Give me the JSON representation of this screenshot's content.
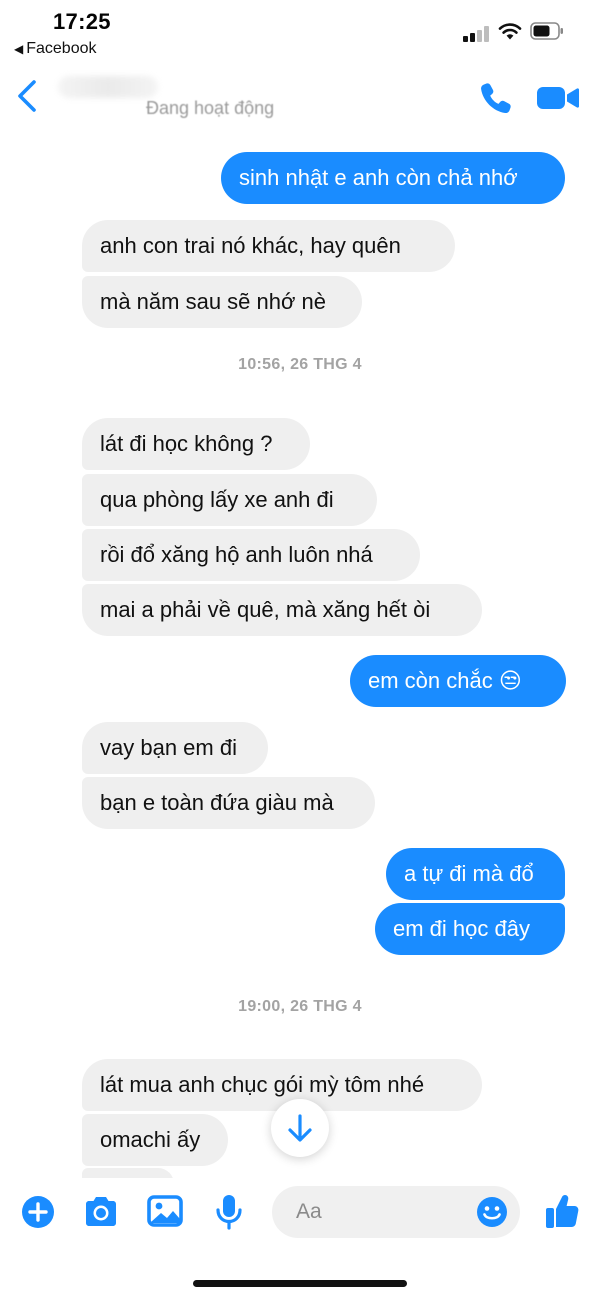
{
  "status_bar": {
    "time": "17:25",
    "back_app": "Facebook"
  },
  "header": {
    "active_status": "Đang hoạt động"
  },
  "messages": [
    {
      "side": "out",
      "text": "sinh nhật e anh còn chả nhớ"
    },
    {
      "side": "in",
      "text": "anh con trai nó khác, hay quên"
    },
    {
      "side": "in",
      "text": "mà năm sau sẽ nhớ nè"
    },
    {
      "side": "in",
      "text": "lát đi học không ?"
    },
    {
      "side": "in",
      "text": "qua phòng lấy xe anh đi"
    },
    {
      "side": "in",
      "text": "rồi đổ xăng hộ anh luôn nhá"
    },
    {
      "side": "in",
      "text": "mai a phải về quê, mà xăng hết òi"
    },
    {
      "side": "out",
      "text": "em còn chắc 😒"
    },
    {
      "side": "in",
      "text": "vay bạn em đi"
    },
    {
      "side": "in",
      "text": "bạn e toàn đứa giàu mà"
    },
    {
      "side": "out",
      "text": "a tự đi mà đổ"
    },
    {
      "side": "out",
      "text": "em đi học đây"
    },
    {
      "side": "in",
      "text": "lát mua anh chục gói mỳ tôm nhé"
    },
    {
      "side": "in",
      "text": "omachi ấy"
    }
  ],
  "timestamps": [
    "10:56, 26 THG 4",
    "19:00, 26 THG 4"
  ],
  "composer": {
    "placeholder": "Aa"
  },
  "icons": {
    "back": "chevron-left-icon",
    "call": "phone-icon",
    "video": "video-camera-icon",
    "scroll": "arrow-down-icon",
    "plus": "plus-circle-icon",
    "camera": "camera-icon",
    "gallery": "image-icon",
    "mic": "microphone-icon",
    "emoji": "smiley-icon",
    "like": "thumbs-up-icon"
  },
  "colors": {
    "accent": "#1a8cff",
    "incoming_bubble": "#efefef",
    "timestamp": "#a3a3a3"
  }
}
